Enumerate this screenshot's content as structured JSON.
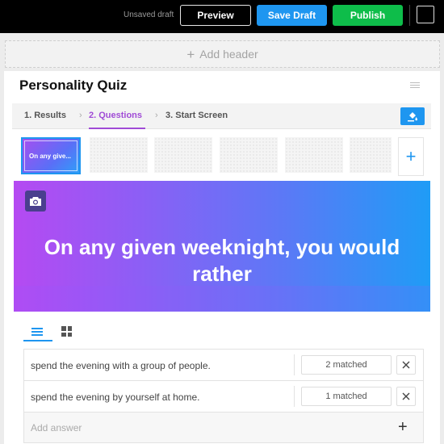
{
  "topbar": {
    "status": "Unsaved draft",
    "preview_label": "Preview",
    "save_label": "Save Draft",
    "publish_label": "Publish",
    "color_square_icon": "color-square-icon"
  },
  "add_header": {
    "label": "Add header",
    "icon": "plus-icon"
  },
  "quiz": {
    "title": "Personality Quiz",
    "tabs": [
      {
        "label": "1. Results"
      },
      {
        "label": "2. Questions"
      },
      {
        "label": "3. Start Screen"
      }
    ],
    "active_tab": "2. Questions",
    "theme_icon": "paint-bucket-icon",
    "thumbnail_label": "On any give...",
    "question": "On any given weeknight, you would rather",
    "answers": [
      {
        "text": "spend the evening with a group of people.",
        "matched": "2 matched"
      },
      {
        "text": "spend the evening by yourself at home.",
        "matched": "1 matched"
      }
    ],
    "add_answer_placeholder": "Add answer"
  },
  "colors": {
    "accent_blue": "#1e96f0",
    "publish_green": "#0ebd4a",
    "tab_active_purple": "#a04bd6"
  }
}
